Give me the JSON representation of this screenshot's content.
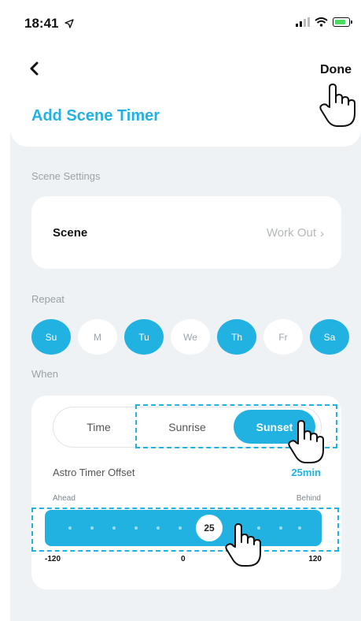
{
  "status_bar": {
    "time": "18:41"
  },
  "nav": {
    "done_label": "Done"
  },
  "page": {
    "title": "Add Scene Timer"
  },
  "scene_settings": {
    "section_label": "Scene Settings",
    "scene_label": "Scene",
    "scene_value": "Work Out"
  },
  "repeat": {
    "section_label": "Repeat",
    "days": [
      {
        "label": "Su",
        "selected": true
      },
      {
        "label": "M",
        "selected": false
      },
      {
        "label": "Tu",
        "selected": true
      },
      {
        "label": "We",
        "selected": false
      },
      {
        "label": "Th",
        "selected": true
      },
      {
        "label": "Fr",
        "selected": false
      },
      {
        "label": "Sa",
        "selected": true
      }
    ]
  },
  "when": {
    "section_label": "When",
    "modes": [
      "Time",
      "Sunrise",
      "Sunset"
    ],
    "selected_mode": "Sunset",
    "offset_label": "Astro Timer Offset",
    "offset_value": "25min",
    "ahead_label": "Ahead",
    "behind_label": "Behind",
    "slider": {
      "min": -120,
      "max": 120,
      "value": 25,
      "value_text": "25"
    },
    "ticks": [
      "-120",
      "0",
      "120"
    ]
  },
  "colors": {
    "accent": "#22b2e2",
    "background": "#eef2f4"
  },
  "icons": [
    "location-arrow-icon",
    "signal-icon",
    "wifi-icon",
    "battery-icon",
    "back-chevron-icon",
    "pointer-hand-icon"
  ]
}
